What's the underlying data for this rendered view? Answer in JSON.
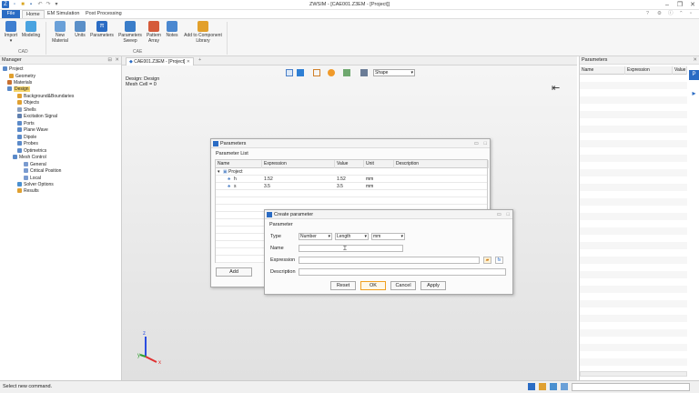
{
  "window": {
    "title": "ZWSIM - [CAE001.Z3EM - [Project]]"
  },
  "menu": {
    "file": "File",
    "tabs": [
      "Home",
      "EM Simulation",
      "Post Processing"
    ]
  },
  "ribbon": {
    "groups": [
      {
        "label": "CAD"
      },
      {
        "label": "CAE"
      }
    ],
    "buttons": {
      "import": "Import",
      "modeling": "Modeling",
      "new_material": "New Material",
      "units": "Units",
      "parameters": "Parameters",
      "parameters_sweep": "Parameters Sweep",
      "pattern_array": "Pattern Array",
      "notes": "Notes",
      "add_to_component": "Add to Component Library"
    }
  },
  "manager": {
    "title": "Manager",
    "tree": [
      {
        "label": "Project"
      },
      {
        "label": "Geometry"
      },
      {
        "label": "Materials"
      },
      {
        "label": "Design"
      },
      {
        "label": "Background&Boundaries"
      },
      {
        "label": "Objects"
      },
      {
        "label": "Shells"
      },
      {
        "label": "Excitation Signal"
      },
      {
        "label": "Ports"
      },
      {
        "label": "Plane Wave"
      },
      {
        "label": "Dipole"
      },
      {
        "label": "Probes"
      },
      {
        "label": "Optimetrics"
      },
      {
        "label": "Mesh Control"
      },
      {
        "label": "General"
      },
      {
        "label": "Critical Position"
      },
      {
        "label": "Local"
      },
      {
        "label": "Solver Options"
      },
      {
        "label": "Results"
      }
    ]
  },
  "document": {
    "tab": "CAE001.Z3EM - [Project]",
    "add_tab": "+",
    "info_line1": "Design: Design",
    "info_line2": "Mesh Cell = 0",
    "view_select": "Shape"
  },
  "parameters_dialog": {
    "title": "Parameters",
    "list_label": "Parameter List",
    "columns": [
      "Name",
      "Expression",
      "Value",
      "Unit",
      "Description"
    ],
    "group": "Project",
    "rows": [
      {
        "name": "h",
        "expression": "1.52",
        "value": "1.52",
        "unit": "mm",
        "description": ""
      },
      {
        "name": "s",
        "expression": "3.5",
        "value": "3.5",
        "unit": "mm",
        "description": ""
      }
    ],
    "add_button": "Add"
  },
  "create_dialog": {
    "title": "Create parameter",
    "section": "Parameter",
    "type_label": "Type",
    "type_value": "Number",
    "kind_value": "Length",
    "unit_value": "mm",
    "name_label": "Name",
    "name_value": "",
    "expression_label": "Expression",
    "expression_value": "",
    "description_label": "Description",
    "description_value": "",
    "reset": "Reset",
    "ok": "OK",
    "cancel": "Cancel",
    "apply": "Apply"
  },
  "right_panel": {
    "title": "Parameters",
    "columns": [
      "Name",
      "Expression",
      "Value"
    ]
  },
  "status": {
    "text": "Select new command."
  },
  "axes": {
    "x": "x",
    "y": "y",
    "z": "z"
  },
  "colors": {
    "accent": "#2b6cc4",
    "selection": "#f5d56b"
  }
}
